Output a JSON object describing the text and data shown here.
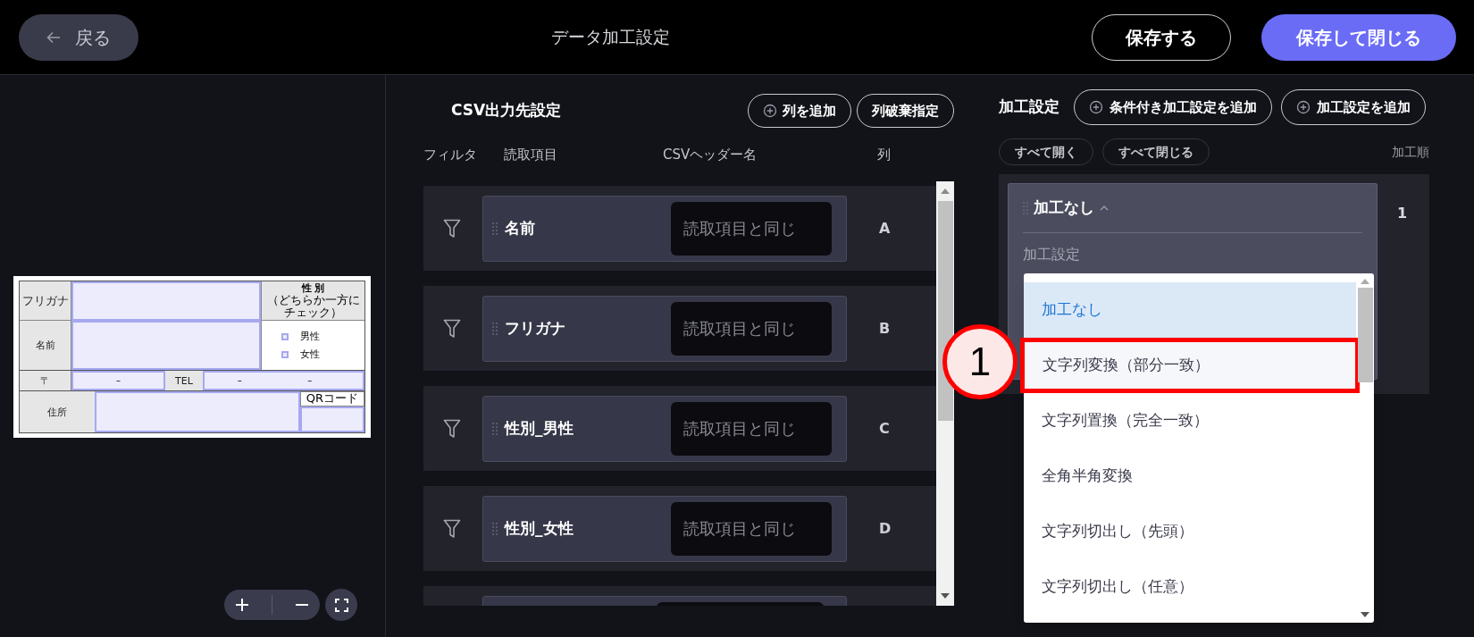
{
  "header": {
    "back_label": "戻る",
    "title": "データ加工設定",
    "buttons": [
      {
        "label": "保存する",
        "kind": "outline"
      },
      {
        "label": "保存して閉じる",
        "kind": "primary"
      }
    ]
  },
  "preview": {
    "form": {
      "furigana": "フリガナ",
      "name": "名前",
      "gender_title": "性 別",
      "gender_note": "（どちらか一方にチェック）",
      "gender_options": [
        "男性",
        "女性"
      ],
      "postal": "〒",
      "postal_dash": "–",
      "tel": "TEL",
      "tel_dashes": [
        "–",
        "–"
      ],
      "address": "住所",
      "qr": "QRコード"
    }
  },
  "csv": {
    "title": "CSV出力先設定",
    "buttons": [
      {
        "label": "列を追加",
        "icon": true
      },
      {
        "label": "列破棄指定",
        "icon": false
      }
    ],
    "columns": [
      "フィルタ",
      "読取項目",
      "CSVヘッダー名",
      "列"
    ],
    "rows": [
      {
        "item": "名前",
        "placeholder": "読取項目と同じ",
        "column": "A"
      },
      {
        "item": "フリガナ",
        "placeholder": "読取項目と同じ",
        "column": "B"
      },
      {
        "item": "性別_男性",
        "placeholder": "読取項目と同じ",
        "column": "C"
      },
      {
        "item": "性別_女性",
        "placeholder": "読取項目と同じ",
        "column": "D"
      }
    ]
  },
  "processing": {
    "title": "加工設定",
    "buttons": [
      {
        "label": "条件付き加工設定を追加",
        "icon": true
      },
      {
        "label": "加工設定を追加",
        "icon": true
      }
    ],
    "toggles": [
      "すべて開く",
      "すべて閉じる"
    ],
    "order_header": "加工順",
    "steps": [
      {
        "name": "加工なし",
        "expanded": true,
        "order": "1",
        "field_label": "加工設定"
      }
    ],
    "dropdown": {
      "options": [
        {
          "label": "加工なし",
          "selected": true,
          "highlighted": false
        },
        {
          "label": "文字列変換（部分一致）",
          "selected": false,
          "highlighted": true
        },
        {
          "label": "文字列置換（完全一致）",
          "selected": false,
          "highlighted": false
        },
        {
          "label": "全角半角変換",
          "selected": false,
          "highlighted": false
        },
        {
          "label": "文字列切出し（先頭）",
          "selected": false,
          "highlighted": false
        },
        {
          "label": "文字列切出し（任意）",
          "selected": false,
          "highlighted": false
        }
      ]
    },
    "annotation": {
      "label": "1"
    }
  }
}
